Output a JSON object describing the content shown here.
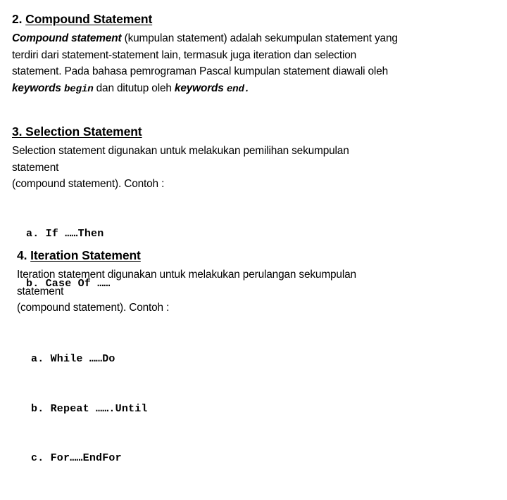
{
  "document": {
    "background_color": "#ffffff",
    "text_color": "#000000",
    "sections": [
      {
        "number": "2.",
        "title": "Compound Statement",
        "body_lines": [
          "Compound statement (kumpulan statement) adalah sekumpulan statement yang",
          "terdiri dari statement-statement lain, termasuk juga iteration dan selection",
          "statement. Pada bahasa pemrograman Pascal kumpulan statement diawali oleh",
          "keywords begin dan ditutup oleh keywords end."
        ],
        "runs": {
          "lead_emphasis": "Compound statement",
          "rest_line1": " (kumpulan statement) adalah sekumpulan statement yang",
          "line2": "terdiri dari statement-statement lain, termasuk juga iteration dan selection",
          "line3": "statement. Pada bahasa pemrograman Pascal kumpulan statement diawali oleh",
          "kw_label_1": "keywords ",
          "kw_begin": "begin",
          "mid_text": " dan ditutup oleh ",
          "kw_label_2": "keywords ",
          "kw_end": "end."
        }
      },
      {
        "number": "3.",
        "title": "Selection Statement",
        "heading_full": "3. Selection Statement",
        "body_lines": [
          "Selection statement digunakan untuk melakukan pemilihan sekumpulan",
          "statement",
          "(compound statement). Contoh :"
        ],
        "examples": [
          "a. If ……Then",
          "b. Case Of ……"
        ]
      },
      {
        "number": "4.",
        "title": "Iteration Statement",
        "body_lines": [
          "Iteration statement digunakan untuk melakukan perulangan sekumpulan",
          "statement",
          "(compound statement). Contoh :"
        ],
        "examples": [
          "a. While ……Do",
          "b. Repeat …….Until",
          "c. For……EndFor"
        ]
      }
    ]
  }
}
